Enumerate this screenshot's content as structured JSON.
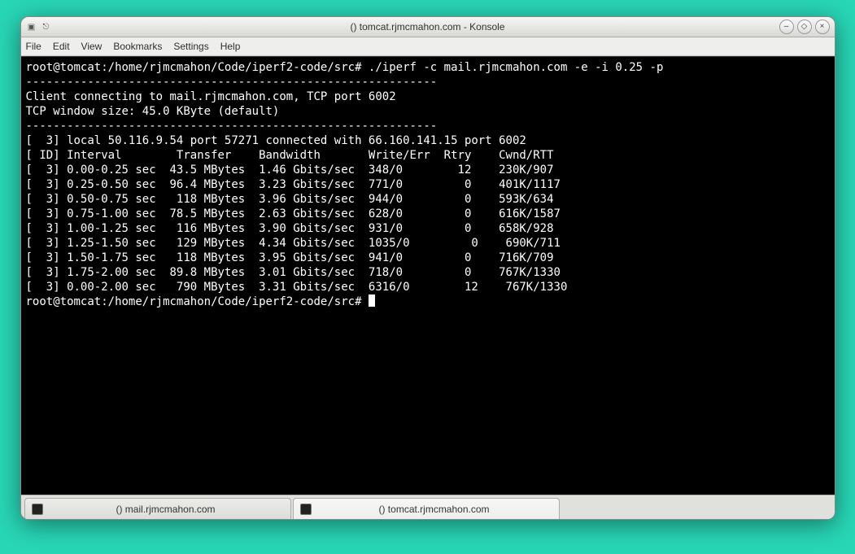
{
  "window": {
    "title": "() tomcat.rjmcmahon.com - Konsole"
  },
  "menu": {
    "file": "File",
    "edit": "Edit",
    "view": "View",
    "bookmarks": "Bookmarks",
    "settings": "Settings",
    "help": "Help"
  },
  "terminal": {
    "prompt1": "root@tomcat:/home/rjmcmahon/Code/iperf2-code/src# ./iperf -c mail.rjmcmahon.com -e -i 0.25 -p ",
    "sep1": "------------------------------------------------------------",
    "line_connect": "Client connecting to mail.rjmcmahon.com, TCP port 6002",
    "line_window": "TCP window size: 45.0 KByte (default)",
    "sep2": "------------------------------------------------------------",
    "local": "[  3] local 50.116.9.54 port 57271 connected with 66.160.141.15 port 6002",
    "header": "[ ID] Interval        Transfer    Bandwidth       Write/Err  Rtry    Cwnd/RTT",
    "rows": [
      "[  3] 0.00-0.25 sec  43.5 MBytes  1.46 Gbits/sec  348/0        12    230K/907",
      "[  3] 0.25-0.50 sec  96.4 MBytes  3.23 Gbits/sec  771/0         0    401K/1117",
      "[  3] 0.50-0.75 sec   118 MBytes  3.96 Gbits/sec  944/0         0    593K/634",
      "[  3] 0.75-1.00 sec  78.5 MBytes  2.63 Gbits/sec  628/0         0    616K/1587",
      "[  3] 1.00-1.25 sec   116 MBytes  3.90 Gbits/sec  931/0         0    658K/928",
      "[  3] 1.25-1.50 sec   129 MBytes  4.34 Gbits/sec  1035/0         0    690K/711",
      "[  3] 1.50-1.75 sec   118 MBytes  3.95 Gbits/sec  941/0         0    716K/709",
      "[  3] 1.75-2.00 sec  89.8 MBytes  3.01 Gbits/sec  718/0         0    767K/1330",
      "[  3] 0.00-2.00 sec   790 MBytes  3.31 Gbits/sec  6316/0        12    767K/1330"
    ],
    "prompt2": "root@tomcat:/home/rjmcmahon/Code/iperf2-code/src# "
  },
  "tabs": {
    "tab1": "() mail.rjmcmahon.com",
    "tab2": "() tomcat.rjmcmahon.com"
  }
}
